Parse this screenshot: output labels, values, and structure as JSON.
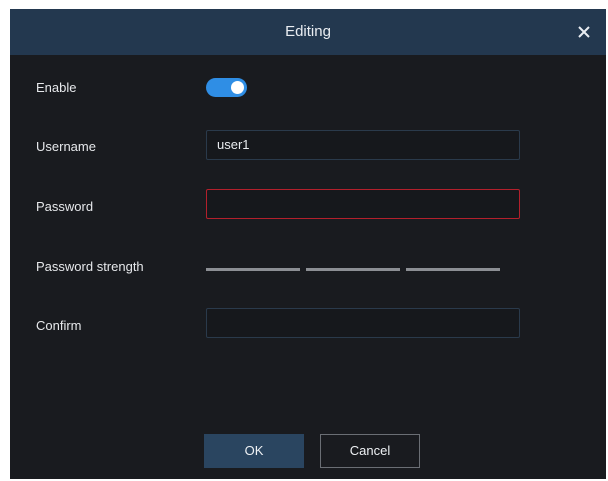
{
  "dialog": {
    "title": "Editing",
    "close_icon": "close-icon"
  },
  "form": {
    "enable_label": "Enable",
    "enable_on": true,
    "username_label": "Username",
    "username_value": "user1",
    "password_label": "Password",
    "password_value": "",
    "password_strength_label": "Password strength",
    "password_strength_segments": 3,
    "password_strength_level": 0,
    "confirm_label": "Confirm",
    "confirm_value": ""
  },
  "buttons": {
    "ok": "OK",
    "cancel": "Cancel"
  },
  "colors": {
    "titlebar": "#23384f",
    "background": "#191b1f",
    "accent": "#2f8ee5",
    "error_border": "#b3202c",
    "ok_button": "#2a4560"
  }
}
